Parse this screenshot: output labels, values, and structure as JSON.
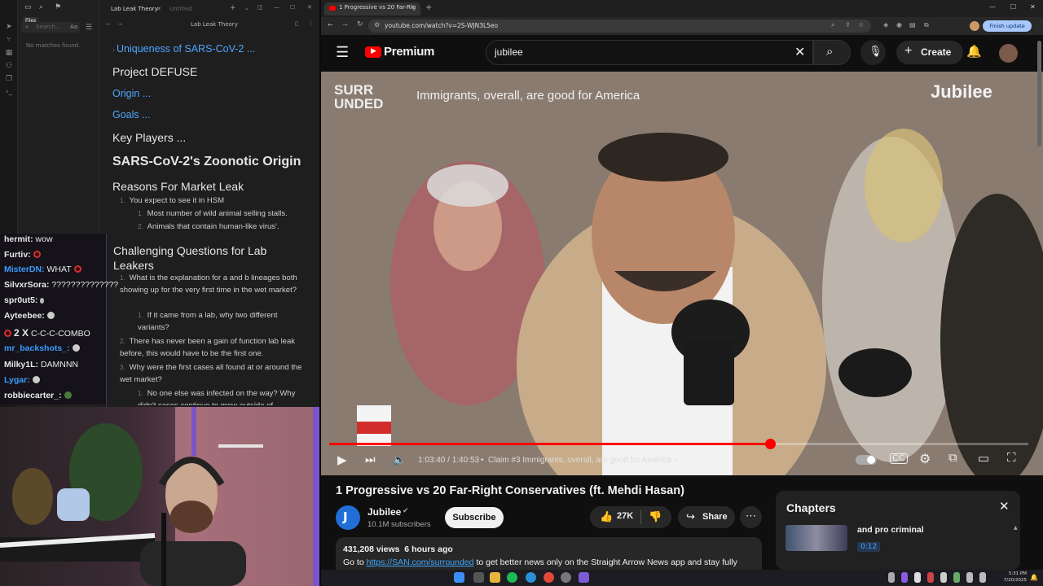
{
  "obsidian": {
    "tooltip": "Files",
    "search_placeholder": "Search...",
    "case_toggle": "Aa",
    "no_matches": "No matches found.",
    "tab_active": "Lab Leak Theory",
    "tab_inactive": "Untitled",
    "note_title": "Lab Leak Theory",
    "headings": {
      "uniqueness": "Uniqueness of SARS-CoV-2 ...",
      "defuse": "Project DEFUSE",
      "origin": "Origin ...",
      "goals": "Goals ...",
      "key_players": "Key Players ...",
      "zoonotic": "SARS-CoV-2's Zoonotic Origin",
      "market_leak": "Reasons For Market Leak",
      "challenging": "Challenging Questions for Lab Leakers"
    },
    "market_list": {
      "item1": "You expect to see it in HSM",
      "item1a": "Most number of wild animal selling stalls.",
      "item1b": "Animals that contain human-like virus'."
    },
    "challenge_list": {
      "item1": "What is the explanation for a and b lineages both showing up for the very first time in the wet market?",
      "item1a": "If it came from a lab, why two different variants?",
      "item2": "There has never been a gain of function lab leak before, this would have to be the first one.",
      "item3": "Why were the first cases all found at or around the wet market?",
      "item3a": "No one else was infected on the way? Why didn't cases continue to grow outside of"
    }
  },
  "chat": {
    "messages": [
      {
        "user": "hermit:",
        "text": "wow",
        "color": "#e8e8e8"
      },
      {
        "user": "Furtiv:",
        "text": "",
        "color": "#e8e8e8"
      },
      {
        "user": "MisterDN:",
        "text": "WHAT",
        "color": "#3a9bff"
      },
      {
        "user": "SilvxrSora:",
        "text": "??????????????",
        "color": "#e8e8e8"
      },
      {
        "user": "spr0ut5:",
        "text": "",
        "color": "#e8e8e8"
      },
      {
        "user": "Ayteebee:",
        "text": "",
        "color": "#e8e8e8"
      },
      {
        "user": "2 X",
        "text": "C-C-C-COMBO",
        "color": "#e8e8e8"
      },
      {
        "user": "mr_backshots_:",
        "text": "",
        "color": "#3a9bff"
      },
      {
        "user": "Milky1L:",
        "text": "DAMNNN",
        "color": "#e8e8e8"
      },
      {
        "user": "Lygar:",
        "text": "",
        "color": "#3a9bff"
      },
      {
        "user": "robbiecarter_:",
        "text": "",
        "color": "#e8e8e8"
      }
    ]
  },
  "browser": {
    "tab_title": "1 Progressive vs 20 Far-Rig",
    "url": "youtube.com/watch?v=2S-WJN3L5eo",
    "update_button": "Finish update"
  },
  "youtube": {
    "logo_text": "Premium",
    "search_value": "jubilee",
    "create_label": "Create",
    "video": {
      "brand_left": "SURR\nUNDED",
      "overlay_caption": "Immigrants, overall, are good for America",
      "brand_right": "Jubilee",
      "time": "1:03:40 / 1:40:53",
      "chapter": "Claim #3 Immigrants, overall, are good for America",
      "progress": 0.63
    },
    "title": "1 Progressive vs 20 Far-Right Conservatives (ft. Mehdi Hasan)",
    "channel_name": "Jubilee",
    "subscribers": "10.1M subscribers",
    "subscribe_label": "Subscribe",
    "likes": "27K",
    "share_label": "Share",
    "views_line": "431,208 views  6 hours ago",
    "desc_prefix": "Go to",
    "desc_link": "https://SAN.com/surrounded",
    "desc_suffix": "to get better news only on the Straight Arrow News app and stay fully",
    "chapters_title": "Chapters",
    "chapter_item_text": "and pro criminal",
    "chapter_item_time": "0:12"
  },
  "taskbar": {
    "time": "5:31 PM",
    "date": "7/20/2025"
  }
}
